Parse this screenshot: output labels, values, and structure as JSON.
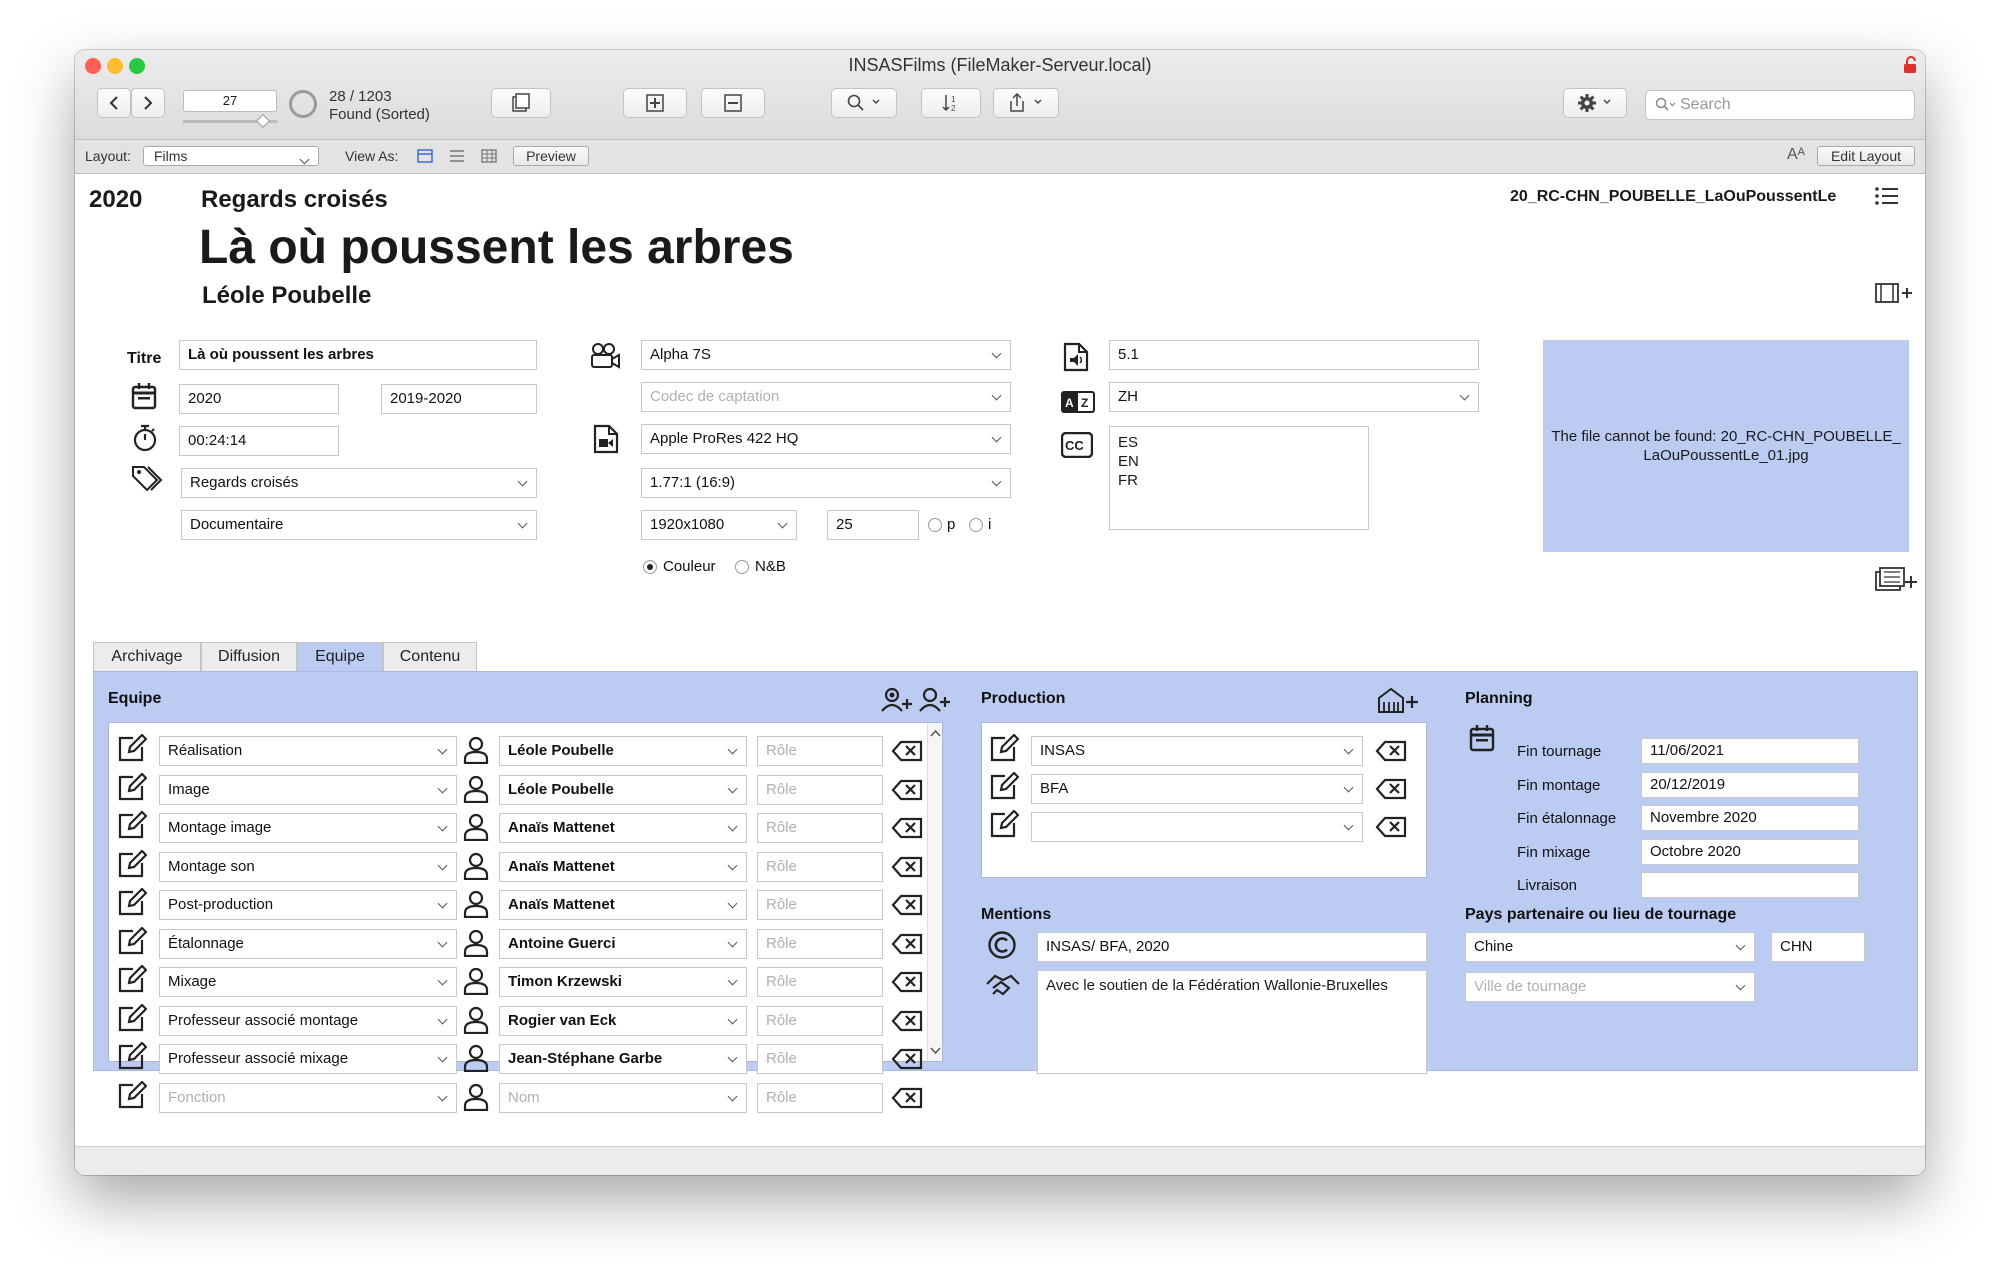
{
  "window": {
    "title": "INSASFilms (FileMaker-Serveur.local)"
  },
  "toolbar": {
    "record_number": "27",
    "found_count": "28 / 1203",
    "found_status": "Found (Sorted)",
    "search_placeholder": "Search"
  },
  "layout_bar": {
    "layout_label": "Layout:",
    "layout_value": "Films",
    "view_as_label": "View As:",
    "preview_label": "Preview",
    "font_icon": "Aᴬ",
    "edit_layout_label": "Edit Layout"
  },
  "header": {
    "year": "2020",
    "category": "Regards croisés",
    "title": "Là où poussent les arbres",
    "director": "Léole Poubelle",
    "record_code": "20_RC-CHN_POUBELLE_LaOuPoussentLe"
  },
  "details": {
    "titre_label": "Titre",
    "titre": "Là où poussent les arbres",
    "year": "2020",
    "season": "2019-2020",
    "duration": "00:24:14",
    "section": "Regards croisés",
    "genre": "Documentaire",
    "camera": "Alpha 7S",
    "capture_codec_placeholder": "Codec de captation",
    "codec": "Apple ProRes 422 HQ",
    "ratio": "1.77:1 (16:9)",
    "resolution": "1920x1080",
    "fps": "25",
    "scan_p": "p",
    "scan_i": "i",
    "color_label": "Couleur",
    "bw_label": "N&B",
    "audio": "5.1",
    "language": "ZH",
    "subtitles": [
      "ES",
      "EN",
      "FR"
    ],
    "poster_message": "The file cannot be found: 20_RC-CHN_POUBELLE_LaOuPoussentLe_01.jpg"
  },
  "tabs": [
    "Archivage",
    "Diffusion",
    "Equipe",
    "Contenu"
  ],
  "equipe": {
    "title": "Equipe",
    "role_placeholder": "Rôle",
    "rows": [
      {
        "fonction": "Réalisation",
        "nom": "Léole Poubelle"
      },
      {
        "fonction": "Image",
        "nom": "Léole Poubelle"
      },
      {
        "fonction": "Montage image",
        "nom": "Anaïs Mattenet"
      },
      {
        "fonction": "Montage son",
        "nom": "Anaïs Mattenet"
      },
      {
        "fonction": "Post-production",
        "nom": "Anaïs Mattenet"
      },
      {
        "fonction": "Étalonnage",
        "nom": "Antoine Guerci"
      },
      {
        "fonction": "Mixage",
        "nom": "Timon Krzewski"
      },
      {
        "fonction": "Professeur associé montage",
        "nom": "Rogier van Eck"
      },
      {
        "fonction": "Professeur associé mixage",
        "nom": "Jean-Stéphane Garbe"
      }
    ],
    "empty_row": {
      "fonction_placeholder": "Fonction",
      "nom_placeholder": "Nom"
    }
  },
  "production": {
    "title": "Production",
    "rows": [
      "INSAS",
      "BFA",
      ""
    ]
  },
  "mentions": {
    "title": "Mentions",
    "copyright": "INSAS/ BFA, 2020",
    "support": "Avec le soutien de la Fédération Wallonie-Bruxelles"
  },
  "planning": {
    "title": "Planning",
    "rows": [
      {
        "label": "Fin tournage",
        "value": "11/06/2021"
      },
      {
        "label": "Fin montage",
        "value": "20/12/2019"
      },
      {
        "label": "Fin étalonnage",
        "value": "Novembre 2020"
      },
      {
        "label": "Fin mixage",
        "value": "Octobre 2020"
      },
      {
        "label": "Livraison",
        "value": ""
      }
    ]
  },
  "pays": {
    "title": "Pays partenaire ou lieu de tournage",
    "country": "Chine",
    "code": "CHN",
    "city_placeholder": "Ville de tournage"
  },
  "colors": {
    "panel": "#bccbf2",
    "poster": "#bccbf2",
    "close": "#ff5f57",
    "minimize": "#febc2e",
    "zoom": "#28c840",
    "lock": "#e0302a"
  }
}
